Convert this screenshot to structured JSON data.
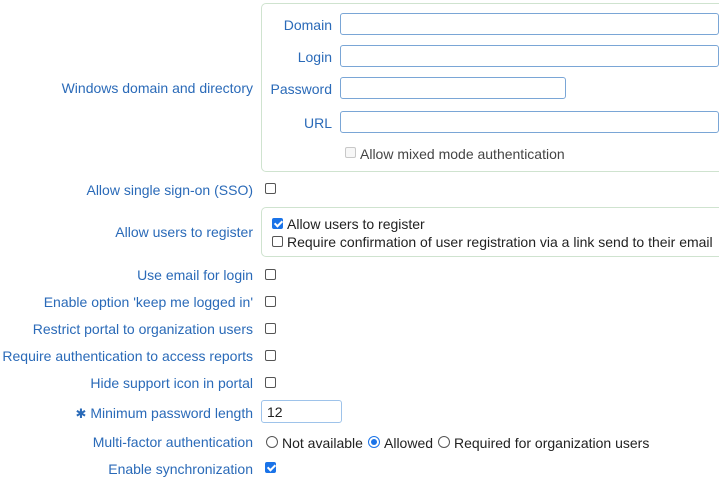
{
  "windows_domain": {
    "label": "Windows domain and directory",
    "domain_label": "Domain",
    "domain_value": "",
    "login_label": "Login",
    "login_value": "",
    "password_label": "Password",
    "password_value": "",
    "url_label": "URL",
    "url_value": "",
    "mixed_mode_label": "Allow mixed mode authentication",
    "mixed_mode_checked": false,
    "mixed_mode_disabled": true
  },
  "sso": {
    "label": "Allow single sign-on (SSO)",
    "checked": false
  },
  "register": {
    "label": "Allow users to register",
    "allow_label": "Allow users to register",
    "allow_checked": true,
    "confirm_label": "Require confirmation of user registration via a link send to their email",
    "confirm_checked": false
  },
  "email_login": {
    "label": "Use email for login",
    "checked": false
  },
  "keep_logged_in": {
    "label": "Enable option 'keep me logged in'",
    "checked": false
  },
  "restrict_portal": {
    "label": "Restrict portal to organization users",
    "checked": false
  },
  "require_auth_reports": {
    "label": "Require authentication to access reports",
    "checked": false
  },
  "hide_support_icon": {
    "label": "Hide support icon in portal",
    "checked": false
  },
  "min_password": {
    "required_marker": "✱",
    "label": "Minimum password length",
    "value": "12"
  },
  "mfa": {
    "label": "Multi-factor authentication",
    "options": [
      "Not available",
      "Allowed",
      "Required for organization users"
    ],
    "selected": "Allowed"
  },
  "sync": {
    "label": "Enable synchronization",
    "checked": true
  },
  "colors": {
    "label_blue": "#2a6ab8",
    "accent": "#1a73e8",
    "group_border": "#cfe3cf"
  }
}
